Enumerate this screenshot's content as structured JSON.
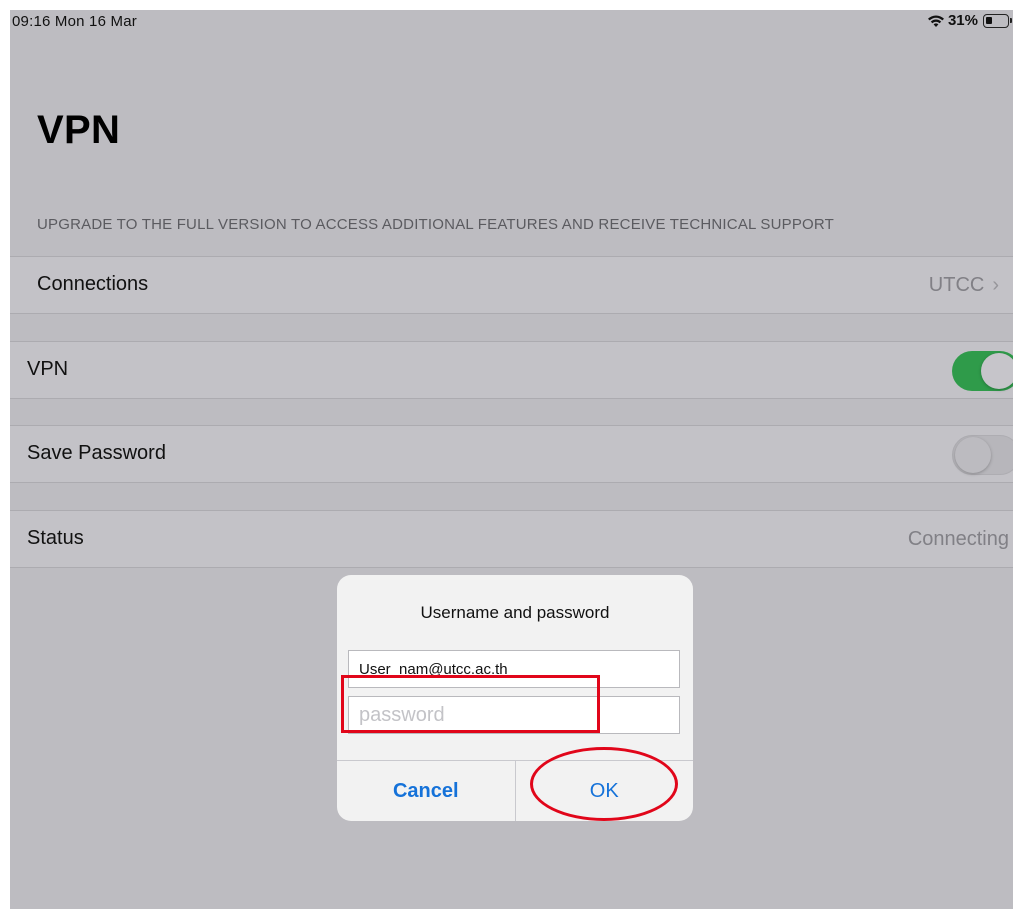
{
  "status_bar": {
    "time_date": "09:16  Mon 16 Mar",
    "battery_percent": "31%",
    "battery_level": 0.31,
    "wifi_icon": "wifi-icon",
    "battery_icon": "battery-icon"
  },
  "title": "VPN",
  "section_header": "UPGRADE TO THE FULL VERSION TO ACCESS ADDITIONAL FEATURES AND RECEIVE TECHNICAL SUPPORT",
  "rows": {
    "connections": {
      "label": "Connections",
      "value": "UTCC",
      "chevron": "›"
    },
    "vpn": {
      "label": "VPN",
      "toggle_on": true
    },
    "save_password": {
      "label": "Save Password",
      "toggle_on": false
    },
    "status": {
      "label": "Status",
      "value": "Connecting"
    }
  },
  "dialog": {
    "title": "Username and password",
    "username_value": "User_nam@utcc.ac.th",
    "password_placeholder": "password",
    "cancel_label": "Cancel",
    "ok_label": "OK"
  },
  "colors": {
    "background": "#bdbcc1",
    "toggle_on": "#2f9b4a",
    "link_blue": "#1572d9",
    "annotation_red": "#e1061a"
  }
}
